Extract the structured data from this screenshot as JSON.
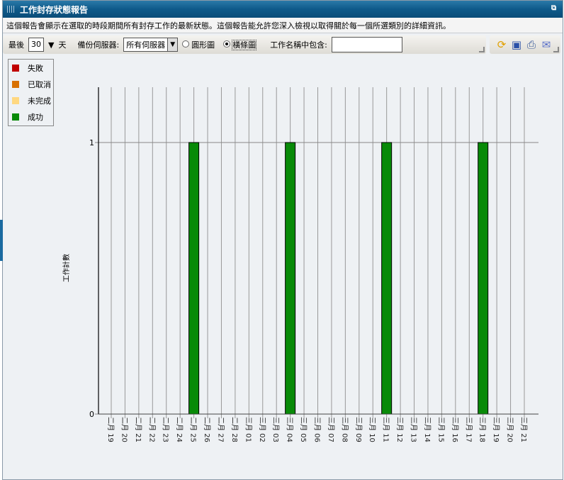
{
  "window": {
    "title": "工作封存狀態報告",
    "description": "這個報告會顯示在選取的時段期間所有封存工作的最新狀態。這個報告能允許您深入檢視以取得關於每一個所選類別的詳細資訊。"
  },
  "toolbar": {
    "last_label": "最後",
    "days_value": "30",
    "days_unit": "天",
    "server_label": "備份伺服器:",
    "server_value": "所有伺服器",
    "pie_label": "圓形圖",
    "bar_label": "橫條圖",
    "name_filter_label": "工作名稱中包含:",
    "name_filter_value": ""
  },
  "icons": [
    "refresh-icon",
    "save-icon",
    "print-icon",
    "email-icon"
  ],
  "legend": [
    {
      "label": "失敗",
      "color": "#c00000"
    },
    {
      "label": "已取消",
      "color": "#d87000"
    },
    {
      "label": "未完成",
      "color": "#ffd880"
    },
    {
      "label": "成功",
      "color": "#088a08"
    }
  ],
  "chart_data": {
    "type": "bar",
    "ylabel": "工作計數",
    "ylim": [
      0,
      1.2
    ],
    "yticks": [
      0,
      1
    ],
    "categories": [
      "二月 19",
      "二月 20",
      "二月 21",
      "二月 22",
      "二月 23",
      "二月 24",
      "二月 25",
      "二月 26",
      "二月 27",
      "二月 28",
      "三月 01",
      "三月 02",
      "三月 03",
      "三月 04",
      "三月 05",
      "三月 06",
      "三月 07",
      "三月 08",
      "三月 09",
      "三月 10",
      "三月 11",
      "三月 12",
      "三月 13",
      "三月 14",
      "三月 15",
      "三月 16",
      "三月 17",
      "三月 18",
      "三月 19",
      "三月 20",
      "三月 21"
    ],
    "series": [
      {
        "name": "成功",
        "color": "#088a08",
        "values": [
          0,
          0,
          0,
          0,
          0,
          0,
          1,
          0,
          0,
          0,
          0,
          0,
          0,
          1,
          0,
          0,
          0,
          0,
          0,
          0,
          1,
          0,
          0,
          0,
          0,
          0,
          0,
          1,
          0,
          0,
          0
        ]
      }
    ]
  }
}
